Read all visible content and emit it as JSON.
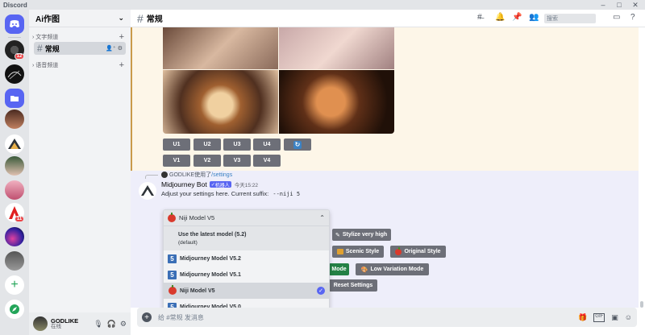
{
  "window": {
    "title": "Discord"
  },
  "server_badges": {
    "s1": "12",
    "s8": "11"
  },
  "guild": {
    "name": "Ai作图"
  },
  "categories": {
    "text": "文字频道",
    "voice": "语音频道"
  },
  "channel": {
    "name": "常规"
  },
  "user": {
    "name": "GODLIKE",
    "status": "在线"
  },
  "header": {
    "channel_name": "常规",
    "search_placeholder": "搜索"
  },
  "upscale_buttons": [
    "U1",
    "U2",
    "U3",
    "U4"
  ],
  "variation_buttons": [
    "V1",
    "V2",
    "V3",
    "V4"
  ],
  "message": {
    "reply_user": "GODLIKE",
    "reply_text": "使用了",
    "reply_command": "/settings",
    "author": "Midjourney Bot",
    "bot_tag": "机器人",
    "timestamp": "今天15:22",
    "body": "Adjust your settings here. Current suffix:",
    "suffix": "--niji 5"
  },
  "dropdown": {
    "selected": "Niji Model V5",
    "options": [
      {
        "icon": "none",
        "label": "Use the latest model (5.2)",
        "sub": "(default)"
      },
      {
        "icon": "5",
        "label": "Midjourney Model V5.2"
      },
      {
        "icon": "5",
        "label": "Midjourney Model V5.1"
      },
      {
        "icon": "apple",
        "label": "Niji Model V5",
        "checked": true
      },
      {
        "icon": "5",
        "label": "Midjourney Model V5.0"
      }
    ]
  },
  "settings_buttons": {
    "stylize": "Stylize very high",
    "scenic": "Scenic Style",
    "original": "Original Style",
    "mode": "Mode",
    "low_variation": "Low Variation Mode",
    "reset": "Reset Settings"
  },
  "composer": {
    "placeholder": "给 #常规 发消息"
  },
  "colors": {
    "accent": "#5865f2",
    "active_green": "#248046",
    "button_gray": "#6d6f78",
    "highlight_bg": "#fdf6e8"
  }
}
